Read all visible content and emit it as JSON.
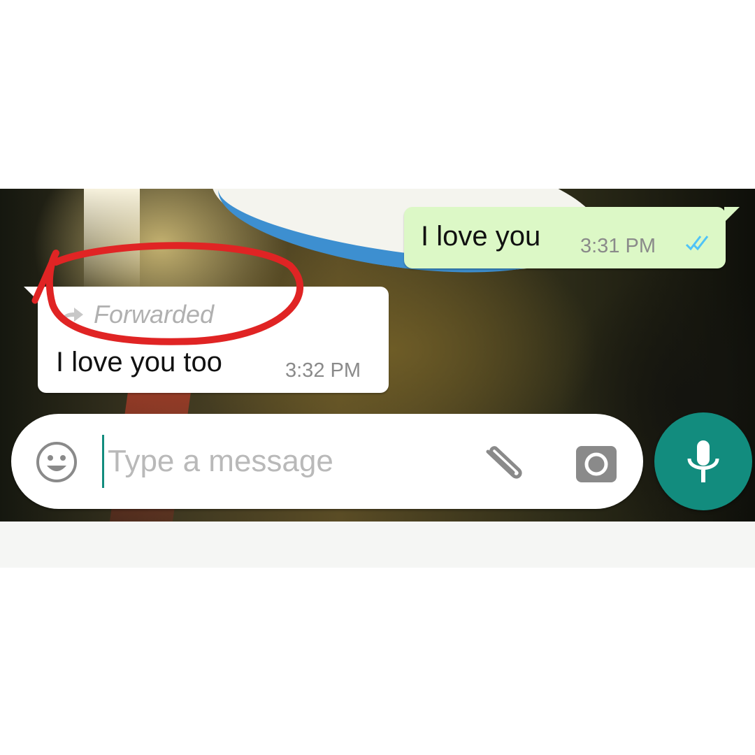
{
  "chat": {
    "outgoing": {
      "text": "I love you",
      "time": "3:31 PM",
      "status_icon": "double-check-read-icon",
      "status_color": "#4fc3f7"
    },
    "incoming": {
      "forwarded_label": "Forwarded",
      "forward_icon": "forward-arrow-icon",
      "text": "I love you too",
      "time": "3:32 PM"
    }
  },
  "composer": {
    "placeholder": "Type a message",
    "emoji_icon": "emoji-icon",
    "attach_icon": "paperclip-icon",
    "camera_icon": "camera-icon",
    "mic_icon": "mic-icon"
  },
  "colors": {
    "outgoing_bubble": "#dcf8c6",
    "incoming_bubble": "#ffffff",
    "accent": "#128c7e",
    "annotation": "#e02424"
  }
}
